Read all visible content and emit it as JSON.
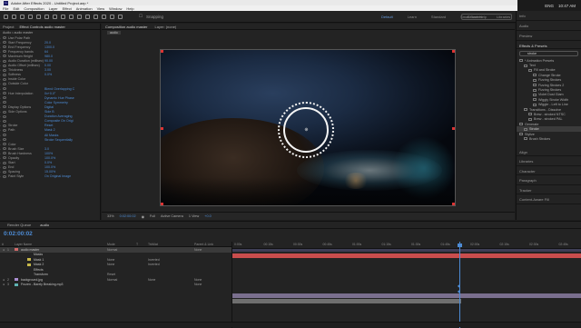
{
  "app": {
    "title": "Adobe After Effects 2020 - Untitled Project.aep *",
    "window_controls": [
      "—",
      "❐",
      "✕"
    ]
  },
  "taskbar": {
    "time": "10:47 AM",
    "lang": "ENG"
  },
  "menu": [
    "File",
    "Edit",
    "Composition",
    "Layer",
    "Effect",
    "Animation",
    "View",
    "Window",
    "Help"
  ],
  "workspaces": [
    {
      "label": "Default",
      "active": true
    },
    {
      "label": "Learn",
      "active": false
    },
    {
      "label": "Standard",
      "active": false
    },
    {
      "label": "Small Screen",
      "active": false
    },
    {
      "label": "Libraries",
      "active": false
    }
  ],
  "toolbar": {
    "snapping": "Snapping",
    "search_placeholder": "Search Help"
  },
  "left_panel": {
    "tabs": [
      "Project",
      "Effect Controls audio master"
    ],
    "subtitle": "Audio • audio master",
    "rows": [
      {
        "name": "Use Polar Path",
        "value": ""
      },
      {
        "name": "Start Frequency",
        "value": "20.0"
      },
      {
        "name": "End Frequency",
        "value": "1300.0"
      },
      {
        "name": "Frequency bands",
        "value": "64"
      },
      {
        "name": "Maximum Height",
        "value": "980.0"
      },
      {
        "name": "Audio Duration (millisec)",
        "value": "90.00"
      },
      {
        "name": "Audio Offset (millisec)",
        "value": "0.00"
      },
      {
        "name": "Thickness",
        "value": "3.00"
      },
      {
        "name": "Softness",
        "value": "0.0%"
      },
      {
        "name": "Inside Color",
        "value": ""
      },
      {
        "name": "Outside Color",
        "value": ""
      },
      {
        "name": "",
        "value": "Blend Overlapping C"
      },
      {
        "name": "Hue Interpolation",
        "value": "0x+0.0°"
      },
      {
        "name": "",
        "value": "Dynamic Hue Phase"
      },
      {
        "name": "",
        "value": "Color Symmetry"
      },
      {
        "name": "Display Options",
        "value": "Digital"
      },
      {
        "name": "Side Options",
        "value": "Side B"
      },
      {
        "name": "",
        "value": "Duration Averaging"
      },
      {
        "name": "",
        "value": "Composite On Origi"
      },
      {
        "name": "Stroke",
        "value": "Reset"
      },
      {
        "name": "Path",
        "value": "Mask 2"
      },
      {
        "name": "",
        "value": "All Masks"
      },
      {
        "name": "",
        "value": "Stroke Sequentially"
      },
      {
        "name": "Color",
        "value": ""
      },
      {
        "name": "Brush Size",
        "value": "3.0"
      },
      {
        "name": "Brush Hardness",
        "value": "100%"
      },
      {
        "name": "Opacity",
        "value": "100.0%"
      },
      {
        "name": "Start",
        "value": "0.0%"
      },
      {
        "name": "End",
        "value": "100.0%"
      },
      {
        "name": "Spacing",
        "value": "15.00%"
      },
      {
        "name": "Paint Style",
        "value": "On Original Image"
      }
    ]
  },
  "viewer": {
    "tabs": [
      "Composition audio master",
      "Layer: (none)"
    ],
    "breadcrumb": "audio",
    "footer": [
      "33%",
      "0:02:00:02",
      "Full",
      "Active Camera",
      "1 View",
      "+0.0"
    ]
  },
  "right_panel": {
    "sections": [
      "Info",
      "Audio",
      "Preview",
      "Effects & Presets"
    ],
    "search_value": "stroke",
    "tree": [
      {
        "label": "* Animation Presets",
        "indent": 0
      },
      {
        "label": "Text",
        "indent": 1
      },
      {
        "label": "Fill and Stroke",
        "indent": 2
      },
      {
        "label": "Change Stroke",
        "indent": 3
      },
      {
        "label": "Fizzing Strokes",
        "indent": 3
      },
      {
        "label": "Fizzing Strokes 2",
        "indent": 3
      },
      {
        "label": "Fizzing Strokes",
        "indent": 3
      },
      {
        "label": "Violet Dust Glam",
        "indent": 3
      },
      {
        "label": "Wiggly Stroke Width",
        "indent": 3
      },
      {
        "label": "Wiggle - Left to Line",
        "indent": 3
      },
      {
        "label": "Transitions - Dissolve",
        "indent": 1
      },
      {
        "label": "Brew - stroked NTSC",
        "indent": 2
      },
      {
        "label": "Brew - stroked PAL",
        "indent": 2
      },
      {
        "label": "Generate",
        "indent": 0
      },
      {
        "label": "Stroke",
        "indent": 1,
        "selected": true
      },
      {
        "label": "Stylize",
        "indent": 0
      },
      {
        "label": "Brush Strokes",
        "indent": 1
      }
    ],
    "bottom_sections": [
      "Align",
      "Libraries",
      "Character",
      "Paragraph",
      "Tracker",
      "Content-Aware Fill"
    ]
  },
  "timeline": {
    "tabs": [
      "Render Queue",
      "audio"
    ],
    "timecode": "0:02:00:02",
    "columns": [
      "#",
      "Layer Name",
      "Mode",
      "T",
      "TrkMat",
      "Parent & Link"
    ],
    "layers": [
      {
        "num": "1",
        "name": "audio master",
        "mode": "Normal",
        "trkmat": "",
        "parent": "None",
        "selected": true,
        "color": "#d16b6b"
      },
      {
        "num": "",
        "name": "Masks",
        "mode": "",
        "trkmat": "",
        "parent": "",
        "selected": false,
        "color": ""
      },
      {
        "num": "",
        "name": "Mask 1",
        "mode": "None",
        "trkmat": "Inverted",
        "parent": "",
        "selected": false,
        "color": "#c7b84a"
      },
      {
        "num": "",
        "name": "Mask 2",
        "mode": "None",
        "trkmat": "Inverted",
        "parent": "",
        "selected": false,
        "color": "#c7b84a"
      },
      {
        "num": "",
        "name": "Effects",
        "mode": "",
        "trkmat": "",
        "parent": "",
        "selected": false,
        "color": ""
      },
      {
        "num": "",
        "name": "Transform",
        "mode": "Reset",
        "trkmat": "",
        "parent": "",
        "selected": false,
        "color": ""
      },
      {
        "num": "2",
        "name": "background.jpg",
        "mode": "Normal",
        "trkmat": "None",
        "parent": "None",
        "selected": false,
        "color": "#a98dd0"
      },
      {
        "num": "3",
        "name": "Frozen - Barely Breaking.mp3",
        "mode": "",
        "trkmat": "",
        "parent": "None",
        "selected": false,
        "color": "#5fb3b3"
      }
    ],
    "ruler_ticks": [
      "0:00s",
      "00:15s",
      "00:30s",
      "00:45s",
      "01:00s",
      "01:15s",
      "01:30s",
      "01:45s",
      "02:00s",
      "02:15s",
      "02:30s",
      "02:45s"
    ]
  },
  "colors": {
    "accent": "#4d8bd4",
    "layer_bar_red": "#c94d4d",
    "layer_bar_gray": "#6f6f6f"
  }
}
